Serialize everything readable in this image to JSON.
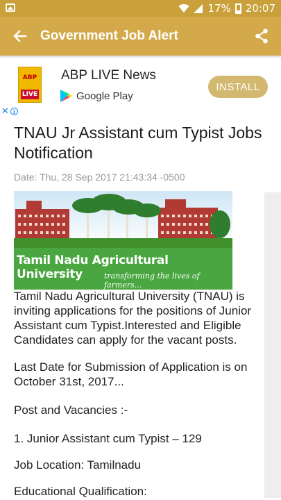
{
  "status_bar": {
    "battery": "17%",
    "time": "20:07"
  },
  "app_bar": {
    "title": "Government Job Alert"
  },
  "ad": {
    "app_name": "ABP LIVE News",
    "store": "Google Play",
    "install_label": "INSTALL",
    "logo_text_top": "ABP",
    "logo_text_bottom": "LIVE",
    "close": "✕",
    "info": "i"
  },
  "article": {
    "title": "TNAU Jr Assistant cum Typist Jobs Notification",
    "date": "Date: Thu, 28 Sep 2017 21:43:34 -0500",
    "banner": {
      "university": "Tamil Nadu Agricultural University",
      "tagline": "transforming the lives of farmers..."
    },
    "intro": "Tamil Nadu Agricultural University (TNAU) is inviting applications for the positions of Junior Assistant cum Typist.Interested and Eligible Candidates can apply for the vacant posts.",
    "last_date": "Last Date for Submission of Application is on October 31st, 2017...",
    "post_heading": "Post and Vacancies :-",
    "vacancy": "1. Junior Assistant cum Typist – 129",
    "location_label": "Job Location",
    "location_value": ": Tamilnadu",
    "education_label": "Educational Qualification",
    "education_value": ":"
  },
  "colors": {
    "status_bar": "#c9a03a",
    "app_bar": "#d4a94a",
    "install": "#d2b96f",
    "banner_green": "#49a640"
  }
}
